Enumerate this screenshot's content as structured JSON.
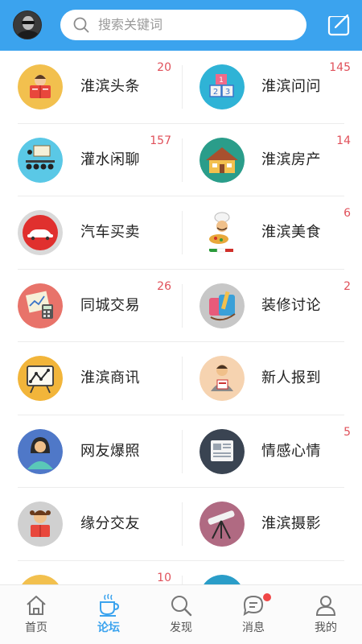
{
  "header": {
    "search_placeholder": "搜索关键词"
  },
  "forums": [
    {
      "left": {
        "label": "淮滨头条",
        "count": "20",
        "icon": "reading-person-icon"
      },
      "right": {
        "label": "淮滨问问",
        "count": "145",
        "icon": "number-blocks-icon"
      }
    },
    {
      "left": {
        "label": "灌水闲聊",
        "count": "157",
        "icon": "meeting-audience-icon"
      },
      "right": {
        "label": "淮滨房产",
        "count": "14",
        "icon": "house-icon"
      }
    },
    {
      "left": {
        "label": "汽车买卖",
        "count": "",
        "icon": "car-icon"
      },
      "right": {
        "label": "淮滨美食",
        "count": "6",
        "icon": "chef-food-icon"
      }
    },
    {
      "left": {
        "label": "同城交易",
        "count": "26",
        "icon": "calculator-chart-icon"
      },
      "right": {
        "label": "装修讨论",
        "count": "2",
        "icon": "paint-tools-icon"
      }
    },
    {
      "left": {
        "label": "淮滨商讯",
        "count": "",
        "icon": "trend-board-icon"
      },
      "right": {
        "label": "新人报到",
        "count": "",
        "icon": "newcomer-icon"
      }
    },
    {
      "left": {
        "label": "网友爆照",
        "count": "",
        "icon": "woman-portrait-icon"
      },
      "right": {
        "label": "情感心情",
        "count": "5",
        "icon": "document-icon"
      }
    },
    {
      "left": {
        "label": "缘分交友",
        "count": "",
        "icon": "girl-reading-icon"
      },
      "right": {
        "label": "淮滨摄影",
        "count": "",
        "icon": "telescope-icon"
      }
    },
    {
      "left": {
        "label": "",
        "count": "10",
        "icon": "partial-icon"
      },
      "right": {
        "label": "",
        "count": "",
        "icon": "partial-icon"
      }
    }
  ],
  "tabs": [
    {
      "label": "首页",
      "icon": "home-icon",
      "active": false
    },
    {
      "label": "论坛",
      "icon": "coffee-cup-icon",
      "active": true
    },
    {
      "label": "发现",
      "icon": "search-icon",
      "active": false
    },
    {
      "label": "消息",
      "icon": "message-icon",
      "active": false
    },
    {
      "label": "我的",
      "icon": "user-icon",
      "active": false
    }
  ],
  "colors": {
    "header_blue": "#3ba3ee",
    "count_red": "#e0505a",
    "active_tab": "#3ba3ee"
  }
}
